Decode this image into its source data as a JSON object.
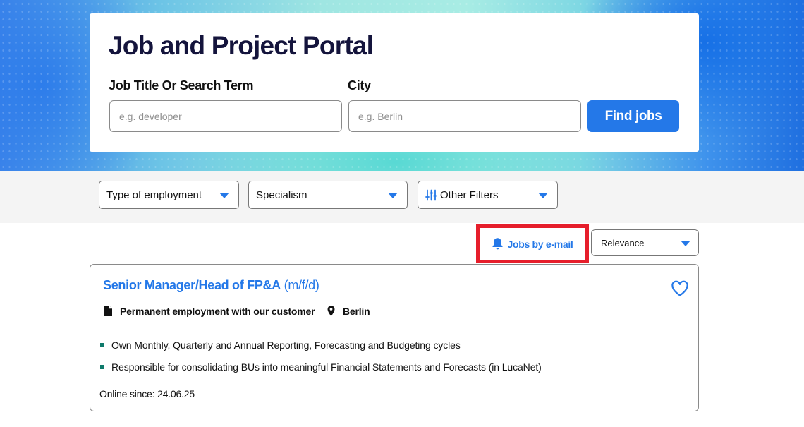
{
  "hero": {
    "title": "Job and Project Portal",
    "job_label": "Job Title Or Search Term",
    "job_placeholder": "e.g. developer",
    "city_label": "City",
    "city_placeholder": "e.g. Berlin",
    "find_button": "Find jobs"
  },
  "filters": {
    "employment": "Type of employment",
    "specialism": "Specialism",
    "other": "Other Filters"
  },
  "results": {
    "email_alert": "Jobs by e-mail",
    "sort": "Relevance"
  },
  "job": {
    "title": "Senior Manager/Head of FP&A",
    "title_suffix": "(m/f/d)",
    "employment_type": "Permanent employment with our customer",
    "location": "Berlin",
    "bullets": [
      "Own Monthly, Quarterly and Annual Reporting, Forecasting and Budgeting cycles",
      "Responsible for consolidating BUs into meaningful Financial Statements and Forecasts (in LucaNet)"
    ],
    "online_since": "Online since: 24.06.25"
  },
  "colors": {
    "accent": "#2478e8",
    "title_dark": "#14143c",
    "highlight_border": "#e61e2b",
    "bullet": "#0e7a6b"
  },
  "icons": [
    "bell-icon",
    "filter-sliders-icon",
    "chevron-down-icon",
    "heart-icon",
    "document-icon",
    "location-pin-icon"
  ]
}
